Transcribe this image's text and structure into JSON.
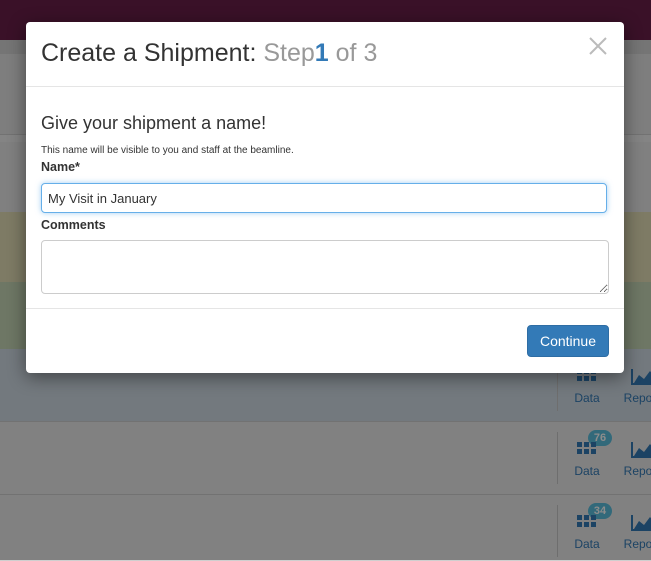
{
  "modal": {
    "title_prefix": "Create a Shipment:",
    "title_step": "Step",
    "title_step_number": "1",
    "title_of": "of 3",
    "heading": "Give your shipment a name!",
    "help_text": "This name will be visible to you and staff at the beamline.",
    "name_label": "Name",
    "required_marker": "*",
    "name_value": "My Visit in January",
    "comments_label": "Comments",
    "comments_value": "",
    "continue_label": "Continue",
    "close_icon": "close-icon"
  },
  "background": {
    "rows": [
      {
        "data_label": "Data",
        "report_label": "Repor",
        "badge": ""
      },
      {
        "data_label": "Data",
        "report_label": "Repor",
        "badge": "76"
      },
      {
        "data_label": "Data",
        "report_label": "Repor",
        "badge": "34"
      }
    ]
  },
  "colors": {
    "accent": "#337ab7",
    "topbar": "#6b1f4a",
    "badge": "#5bc0de"
  }
}
